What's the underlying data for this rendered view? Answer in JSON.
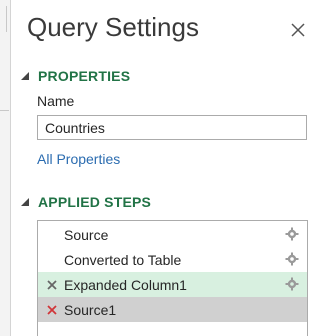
{
  "pane": {
    "title": "Query Settings",
    "close_icon": "close-icon"
  },
  "properties": {
    "heading": "PROPERTIES",
    "name_label": "Name",
    "name_value": "Countries",
    "all_properties_link": "All Properties"
  },
  "applied_steps": {
    "heading": "APPLIED STEPS",
    "steps": [
      {
        "label": "Source",
        "state": "normal",
        "has_settings": true
      },
      {
        "label": "Converted to Table",
        "state": "normal",
        "has_settings": true
      },
      {
        "label": "Expanded Column1",
        "state": "selected",
        "has_settings": true,
        "icon": "delete-step-icon"
      },
      {
        "label": "Source1",
        "state": "error",
        "has_settings": false,
        "icon": "delete-step-icon"
      }
    ]
  },
  "colors": {
    "accent_green": "#217346",
    "link_blue": "#2b6cb0",
    "selected_row": "#d8f0e0",
    "error_row": "#d0d0d0",
    "delete_red": "#d13438"
  }
}
